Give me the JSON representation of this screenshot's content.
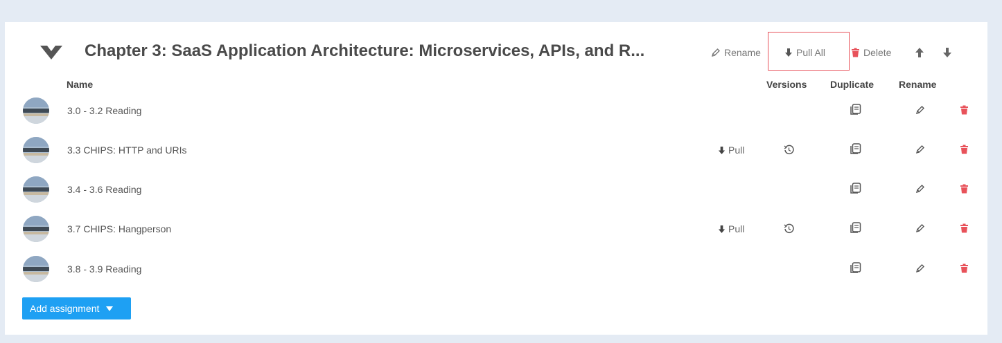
{
  "chapter": {
    "title": "Chapter 3: SaaS Application Architecture: Microservices, APIs, and R...",
    "actions": {
      "rename": "Rename",
      "pull_all": "Pull All",
      "delete": "Delete"
    }
  },
  "columns": {
    "name": "Name",
    "versions": "Versions",
    "duplicate": "Duplicate",
    "rename": "Rename"
  },
  "assignments": [
    {
      "name": "3.0 - 3.2 Reading",
      "pull": ""
    },
    {
      "name": "3.3 CHIPS: HTTP and URIs",
      "pull": "Pull"
    },
    {
      "name": "3.4 - 3.6 Reading",
      "pull": ""
    },
    {
      "name": "3.7 CHIPS: Hangperson",
      "pull": "Pull"
    },
    {
      "name": "3.8 - 3.9 Reading",
      "pull": ""
    }
  ],
  "add_button": {
    "label": "Add assignment"
  },
  "icons": {
    "collapse": "chevron-down-icon",
    "rename": "pencil-icon",
    "pull": "arrow-down-icon",
    "delete": "trash-icon",
    "move_up": "arrow-up-icon",
    "move_down": "arrow-down-icon",
    "versions": "history-icon",
    "duplicate": "copy-icon",
    "dropdown": "caret-down-icon"
  },
  "colors": {
    "background": "#e4ebf4",
    "accent": "#1ea0f3",
    "danger": "#e8525a",
    "highlight": "#e8525a"
  }
}
